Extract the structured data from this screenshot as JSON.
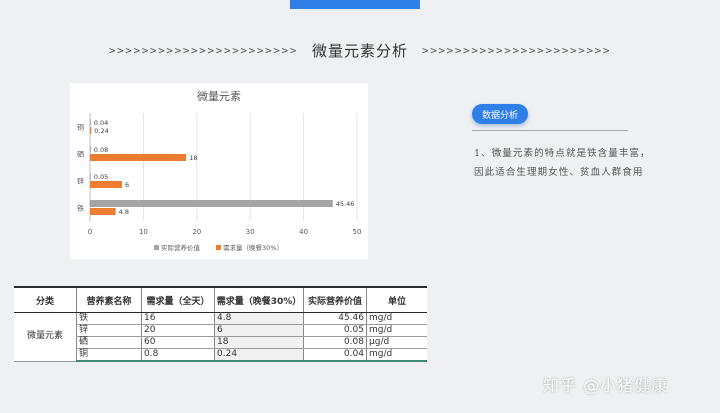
{
  "header": {
    "arrows_left": ">>>>>>>>>>>>>>>>>>>>>>>",
    "title": "微量元素分析",
    "arrows_right": ">>>>>>>>>>>>>>>>>>>>>>>"
  },
  "colors": {
    "accent": "#2f7fe8",
    "series_actual": "#a5a5a5",
    "series_demand": "#ed7d31"
  },
  "chart_data": {
    "type": "bar",
    "orientation": "horizontal",
    "title": "微量元素",
    "categories": [
      "铜",
      "硒",
      "锌",
      "铁"
    ],
    "series": [
      {
        "name": "实际营养价值",
        "values": [
          0.04,
          0.08,
          0.05,
          45.46
        ]
      },
      {
        "name": "需求量（晚餐30%）",
        "values": [
          0.24,
          18,
          6,
          4.8
        ]
      }
    ],
    "data_labels": {
      "actual": [
        "0.04",
        "0.08",
        "0.05",
        "45.46"
      ],
      "demand": [
        "0.24",
        "18",
        "6",
        "4.8"
      ]
    },
    "xlim": [
      0,
      50
    ],
    "xticks": [
      "0",
      "10",
      "20",
      "30",
      "40",
      "50"
    ],
    "grid": true,
    "legend": "bottom"
  },
  "analysis": {
    "badge": "数据分析",
    "line1": "1、微量元素的特点就是铁含量丰富，",
    "line2": "因此适合生理期女性、贫血人群食用"
  },
  "table": {
    "headers": [
      "分类",
      "营养素名称",
      "需求量（全天）",
      "需求量（晚餐30%）",
      "实际营养价值",
      "单位"
    ],
    "category": "微量元素",
    "rows": [
      [
        "铁",
        "16",
        "4.8",
        "45.46",
        "mg/d"
      ],
      [
        "锌",
        "20",
        "6",
        "0.05",
        "mg/d"
      ],
      [
        "硒",
        "60",
        "18",
        "0.08",
        "μg/d"
      ],
      [
        "铜",
        "0.8",
        "0.24",
        "0.04",
        "mg/d"
      ]
    ]
  },
  "watermark": "知乎 @小猪健康"
}
